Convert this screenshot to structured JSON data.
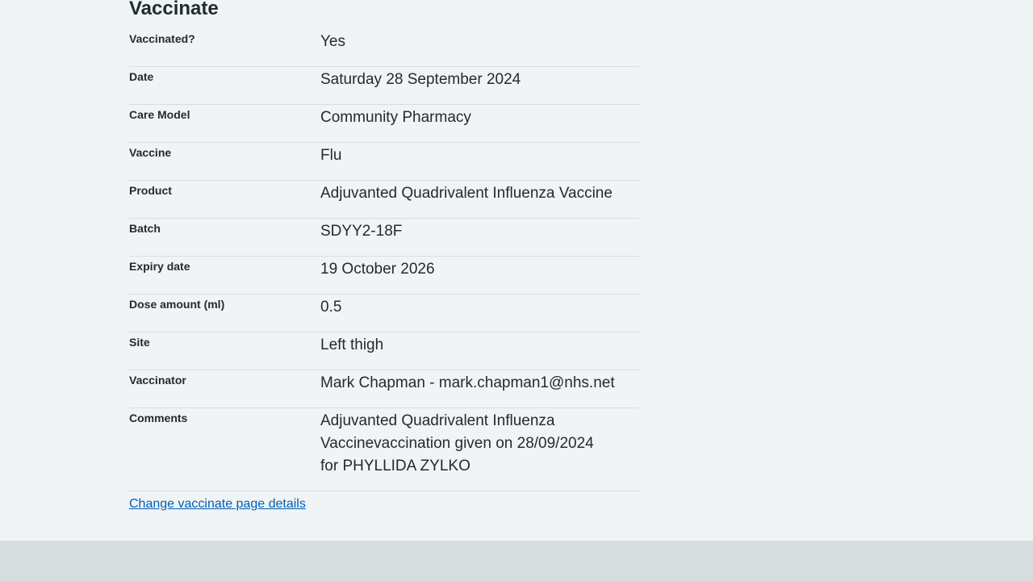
{
  "section": {
    "heading": "Vaccinate"
  },
  "rows": [
    {
      "key": "Vaccinated?",
      "value": "Yes"
    },
    {
      "key": "Date",
      "value": "Saturday 28 September 2024"
    },
    {
      "key": "Care Model",
      "value": "Community Pharmacy"
    },
    {
      "key": "Vaccine",
      "value": "Flu"
    },
    {
      "key": "Product",
      "value": "Adjuvanted Quadrivalent Influenza Vaccine"
    },
    {
      "key": "Batch",
      "value": "SDYY2-18F"
    },
    {
      "key": "Expiry date",
      "value": "19 October 2026"
    },
    {
      "key": "Dose amount (ml)",
      "value": "0.5"
    },
    {
      "key": "Site",
      "value": "Left thigh"
    },
    {
      "key": "Vaccinator",
      "value": "Mark Chapman - mark.chapman1@nhs.net"
    },
    {
      "key": "Comments",
      "value": "Adjuvanted Quadrivalent Influenza Vaccinevaccination given on 28/09/2024 for PHYLLIDA ZYLKO"
    }
  ],
  "links": {
    "change_label": "Change vaccinate page details"
  },
  "colors": {
    "background": "#f0f4f5",
    "footer": "#d8dde0",
    "link": "#005eb8",
    "text": "#212b32",
    "divider": "#d8dde0"
  }
}
